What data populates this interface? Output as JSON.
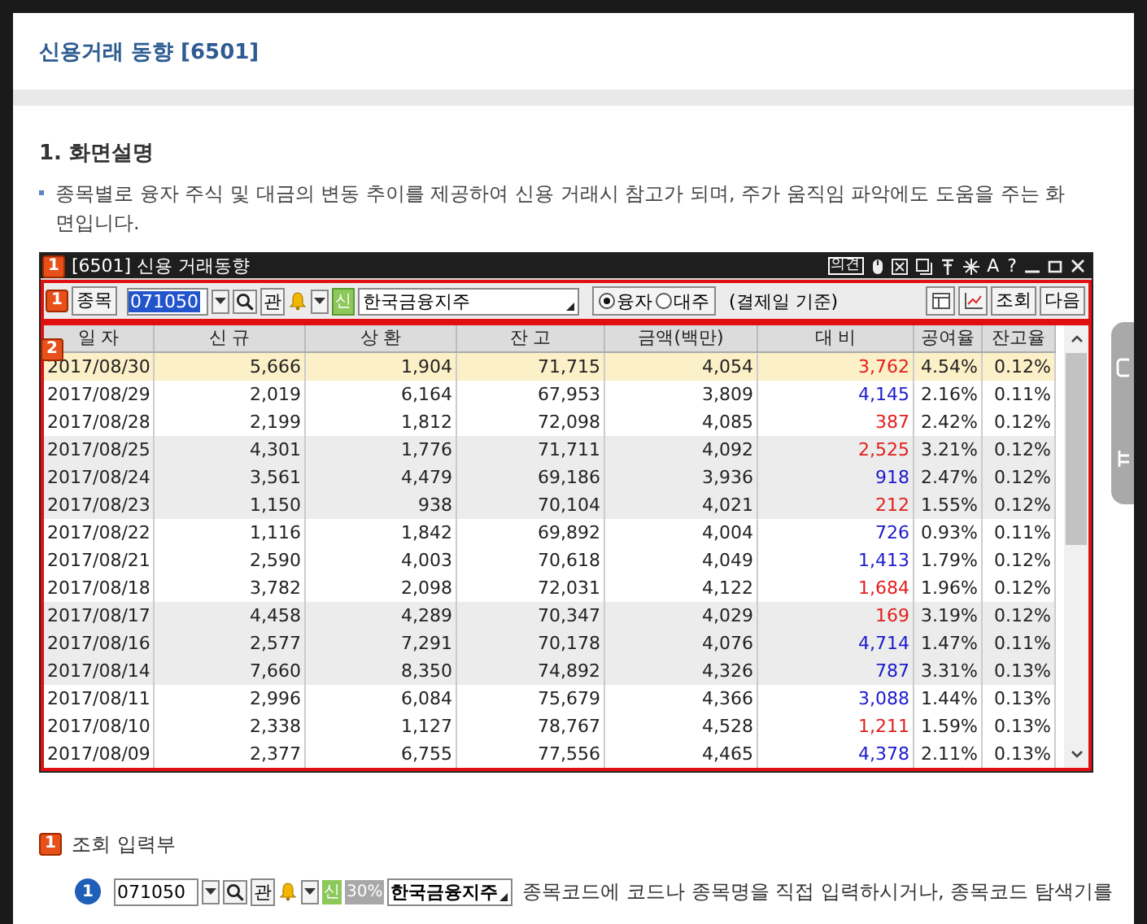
{
  "page_title": "신용거래 동향 [6501]",
  "section_heading": "1. 화면설명",
  "description": "종목별로 융자 주식 및 대금의 변동 추이를 제공하여 신용 거래시 참고가 되며, 주가 움직임 파악에도 도움을 주는 화면입니다.",
  "app_window": {
    "badge": "1",
    "title": "[6501] 신용 거래동향",
    "title_buttons": [
      "의견",
      "A",
      "?"
    ],
    "toolbar": {
      "badge": "1",
      "stock_button": "종목",
      "code": "071050",
      "watch_button": "관",
      "credit_tag": "신",
      "stock_name": "한국금융지주",
      "radios": [
        {
          "label": "융자",
          "selected": true
        },
        {
          "label": "대주",
          "selected": false
        }
      ],
      "basis_note": "(결제일 기준)",
      "buttons": [
        "조회",
        "다음"
      ]
    },
    "table": {
      "badge": "2",
      "columns": [
        "일 자",
        "신 규",
        "상 환",
        "잔 고",
        "금액(백만)",
        "대 비",
        "공여율",
        "잔고율"
      ],
      "rows": [
        {
          "selected": true,
          "color": "#e0201e",
          "cells": [
            "2017/08/30",
            "5,666",
            "1,904",
            "71,715",
            "4,054",
            "3,762",
            "4.54%",
            "0.12%"
          ]
        },
        {
          "selected": false,
          "color": "#1a1acc",
          "cells": [
            "2017/08/29",
            "2,019",
            "6,164",
            "67,953",
            "3,809",
            "4,145",
            "2.16%",
            "0.11%"
          ]
        },
        {
          "selected": false,
          "color": "#e0201e",
          "cells": [
            "2017/08/28",
            "2,199",
            "1,812",
            "72,098",
            "4,085",
            "387",
            "2.42%",
            "0.12%"
          ]
        },
        {
          "selected": false,
          "color": "#e0201e",
          "cells": [
            "2017/08/25",
            "4,301",
            "1,776",
            "71,711",
            "4,092",
            "2,525",
            "3.21%",
            "0.12%"
          ]
        },
        {
          "selected": false,
          "color": "#1a1acc",
          "cells": [
            "2017/08/24",
            "3,561",
            "4,479",
            "69,186",
            "3,936",
            "918",
            "2.47%",
            "0.12%"
          ]
        },
        {
          "selected": false,
          "color": "#e0201e",
          "cells": [
            "2017/08/23",
            "1,150",
            "938",
            "70,104",
            "4,021",
            "212",
            "1.55%",
            "0.12%"
          ]
        },
        {
          "selected": false,
          "color": "#1a1acc",
          "cells": [
            "2017/08/22",
            "1,116",
            "1,842",
            "69,892",
            "4,004",
            "726",
            "0.93%",
            "0.11%"
          ]
        },
        {
          "selected": false,
          "color": "#1a1acc",
          "cells": [
            "2017/08/21",
            "2,590",
            "4,003",
            "70,618",
            "4,049",
            "1,413",
            "1.79%",
            "0.12%"
          ]
        },
        {
          "selected": false,
          "color": "#e0201e",
          "cells": [
            "2017/08/18",
            "3,782",
            "2,098",
            "72,031",
            "4,122",
            "1,684",
            "1.96%",
            "0.12%"
          ]
        },
        {
          "selected": false,
          "color": "#e0201e",
          "cells": [
            "2017/08/17",
            "4,458",
            "4,289",
            "70,347",
            "4,029",
            "169",
            "3.19%",
            "0.12%"
          ]
        },
        {
          "selected": false,
          "color": "#1a1acc",
          "cells": [
            "2017/08/16",
            "2,577",
            "7,291",
            "70,178",
            "4,076",
            "4,714",
            "1.47%",
            "0.11%"
          ]
        },
        {
          "selected": false,
          "color": "#1a1acc",
          "cells": [
            "2017/08/14",
            "7,660",
            "8,350",
            "74,892",
            "4,326",
            "787",
            "3.31%",
            "0.13%"
          ]
        },
        {
          "selected": false,
          "color": "#1a1acc",
          "cells": [
            "2017/08/11",
            "2,996",
            "6,084",
            "75,679",
            "4,366",
            "3,088",
            "1.44%",
            "0.13%"
          ]
        },
        {
          "selected": false,
          "color": "#e0201e",
          "cells": [
            "2017/08/10",
            "2,338",
            "1,127",
            "78,767",
            "4,528",
            "1,211",
            "1.59%",
            "0.13%"
          ]
        },
        {
          "selected": false,
          "color": "#1a1acc",
          "cells": [
            "2017/08/09",
            "2,377",
            "6,755",
            "77,556",
            "4,465",
            "4,378",
            "2.11%",
            "0.13%"
          ]
        }
      ]
    }
  },
  "input_section": {
    "badge": "1",
    "heading": "조회 입력부",
    "item": {
      "number": "1",
      "code": "071050",
      "watch_button": "관",
      "credit_tag": "신",
      "ratio_tag": "30%",
      "stock_name": "한국금융지주",
      "text": "종목코드에 코드나 종목명을 직접 입력하시거나, 종목코드 탐색기를"
    }
  }
}
